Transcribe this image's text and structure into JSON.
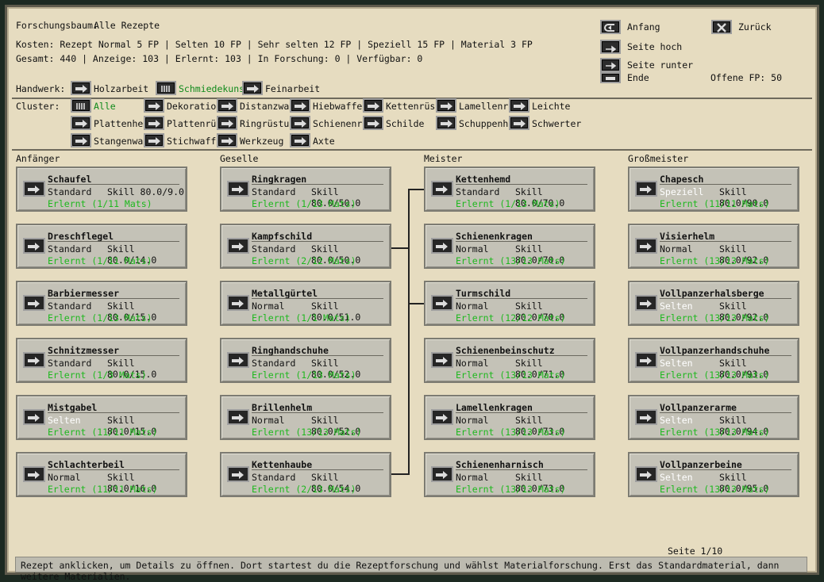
{
  "header": {
    "title_label": "Forschungsbaum:",
    "title_value": "Alle Rezepte",
    "costs": "Kosten: Rezept Normal 5 FP | Selten 10 FP | Sehr selten 12 FP | Speziell 15 FP | Material 3 FP",
    "totals": "Gesamt: 440 | Anzeige: 103 | Erlernt: 103 | In Forschung: 0 | Verfügbar: 0"
  },
  "nav": {
    "anfang": "Anfang",
    "zurueck": "Zurück",
    "seite_hoch": "Seite hoch",
    "seite_runter": "Seite runter",
    "ende": "Ende",
    "offene_fp": "Offene FP: 50"
  },
  "handwerk": {
    "label": "Handwerk:",
    "items": [
      "Holzarbeit",
      "Schmiedekuns",
      "Feinarbeit"
    ],
    "active": "Schmiedekuns"
  },
  "cluster": {
    "label": "Cluster:",
    "items": [
      "Alle",
      "Dekoratio",
      "Distanzwa",
      "Hiebwaffe",
      "Kettenrüs",
      "Lamellenrü",
      "Leichte",
      "Plattenhel",
      "Plattenrü",
      "Ringrüstu",
      "Schienenr",
      "Schilde",
      "Schuppenh",
      "Schwerter",
      "Stangenwa",
      "Stichwaff",
      "Werkzeug",
      "Axte"
    ],
    "active": "Alle"
  },
  "columns": [
    {
      "title": "Anfänger",
      "recipes": [
        {
          "name": "Schaufel",
          "material": "Standard",
          "skill": "Skill 80.0/9.0",
          "learned": "Erlernt (1/11 Mats)"
        },
        {
          "name": "Dreschflegel",
          "material": "Standard",
          "skill": "Skill 80.0/14.0",
          "learned": "Erlernt (1/11 Mats)"
        },
        {
          "name": "Barbiermesser",
          "material": "Standard",
          "skill": "Skill 80.0/15.0",
          "learned": "Erlernt (1/13 Mats)"
        },
        {
          "name": "Schnitzmesser",
          "material": "Standard",
          "skill": "Skill 80.0/15.0",
          "learned": "Erlernt (1/3 Mats)"
        },
        {
          "name": "Mistgabel",
          "material": "Selten",
          "skill": "Skill 80.0/15.0",
          "learned": "Erlernt (11/11 Mats)"
        },
        {
          "name": "Schlachterbeil",
          "material": "Normal",
          "skill": "Skill 80.0/16.0",
          "learned": "Erlernt (11/11 Mats)"
        }
      ]
    },
    {
      "title": "Geselle",
      "recipes": [
        {
          "name": "Ringkragen",
          "material": "Standard",
          "skill": "Skill 80.0/50.0",
          "learned": "Erlernt (1/13 Mats)"
        },
        {
          "name": "Kampfschild",
          "material": "Standard",
          "skill": "Skill 80.0/50.0",
          "learned": "Erlernt (2/12 Mats)"
        },
        {
          "name": "Metallgürtel",
          "material": "Normal",
          "skill": "Skill 80.0/51.0",
          "learned": "Erlernt (1/1 Mats)"
        },
        {
          "name": "Ringhandschuhe",
          "material": "Standard",
          "skill": "Skill 80.0/52.0",
          "learned": "Erlernt (1/13 Mats)"
        },
        {
          "name": "Brillenhelm",
          "material": "Normal",
          "skill": "Skill 80.0/52.0",
          "learned": "Erlernt (13/13 Mats)"
        },
        {
          "name": "Kettenhaube",
          "material": "Standard",
          "skill": "Skill 80.0/54.0",
          "learned": "Erlernt (2/13 Mats)"
        }
      ]
    },
    {
      "title": "Meister",
      "recipes": [
        {
          "name": "Kettenhemd",
          "material": "Standard",
          "skill": "Skill 80.0/70.0",
          "learned": "Erlernt (1/13 Mats)"
        },
        {
          "name": "Schienenkragen",
          "material": "Normal",
          "skill": "Skill 80.0/70.0",
          "learned": "Erlernt (13/13 Mats)"
        },
        {
          "name": "Turmschild",
          "material": "Normal",
          "skill": "Skill 80.0/70.0",
          "learned": "Erlernt (12/12 Mats)"
        },
        {
          "name": "Schienenbeinschutz",
          "material": "Normal",
          "skill": "Skill 80.0/71.0",
          "learned": "Erlernt (13/13 Mats)"
        },
        {
          "name": "Lamellenkragen",
          "material": "Normal",
          "skill": "Skill 80.0/73.0",
          "learned": "Erlernt (13/13 Mats)"
        },
        {
          "name": "Schienenharnisch",
          "material": "Normal",
          "skill": "Skill 80.0/73.0",
          "learned": "Erlernt (13/13 Mats)"
        }
      ]
    },
    {
      "title": "Großmeister",
      "recipes": [
        {
          "name": "Chapesch",
          "material": "Speziell",
          "skill": "Skill 80.0/90.0",
          "learned": "Erlernt (11/11 Mats)"
        },
        {
          "name": "Visierhelm",
          "material": "Normal",
          "skill": "Skill 80.0/92.0",
          "learned": "Erlernt (13/13 Mats)"
        },
        {
          "name": "Vollpanzerhalsberge",
          "material": "Selten",
          "skill": "Skill 80.0/92.0",
          "learned": "Erlernt (13/13 Mats)"
        },
        {
          "name": "Vollpanzerhandschuhe",
          "material": "Selten",
          "skill": "Skill 80.0/93.0",
          "learned": "Erlernt (13/13 Mats)"
        },
        {
          "name": "Vollpanzerarme",
          "material": "Selten",
          "skill": "Skill 80.0/94.0",
          "learned": "Erlernt (13/13 Mats)"
        },
        {
          "name": "Vollpanzerbeine",
          "material": "Selten",
          "skill": "Skill 80.0/95.0",
          "learned": "Erlernt (13/13 Mats)"
        }
      ]
    }
  ],
  "pager": "Seite 1/10",
  "status": "Rezept anklicken, um Details zu öffnen. Dort startest du die Rezeptforschung und wählst Materialforschung. Erst das Standardmaterial, dann weitere Materialien.",
  "colors": {
    "active_green": "#0f8a1a",
    "learned_green": "#1fb81f",
    "parchment": "#e6dcc0",
    "card": "#c4c2b7"
  },
  "icons": {
    "recipe": "arrow-right-icon",
    "cluster": "arrow-right-icon",
    "all": "fork-icon",
    "back": "close-icon",
    "start": "return-icon"
  }
}
